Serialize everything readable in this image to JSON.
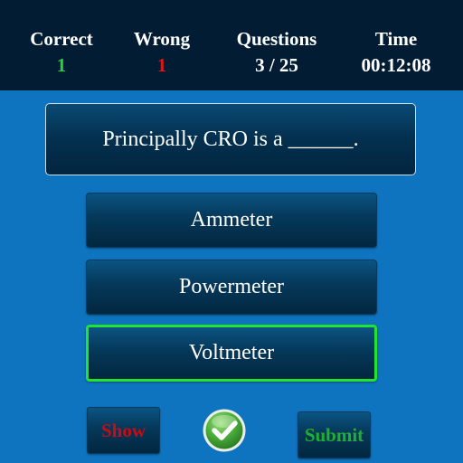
{
  "stats": {
    "correct": {
      "label": "Correct",
      "value": "1"
    },
    "wrong": {
      "label": "Wrong",
      "value": "1"
    },
    "questions": {
      "label": "Questions",
      "value": "3 / 25"
    },
    "time": {
      "label": "Time",
      "value": "00:12:08"
    }
  },
  "question": {
    "text": "Principally CRO is a ______."
  },
  "options": [
    {
      "label": "Ammeter",
      "selected": false
    },
    {
      "label": "Powermeter",
      "selected": false
    },
    {
      "label": "Voltmeter",
      "selected": true
    }
  ],
  "buttons": {
    "show": "Show",
    "submit": "Submit",
    "check_icon": "check-icon"
  },
  "colors": {
    "background": "#0f74bf",
    "header": "#021d33",
    "correct_value": "#27d23c",
    "wrong_value": "#e01616",
    "selected_border": "#22e330",
    "show_text": "#cc0a12",
    "submit_text": "#1fb032"
  }
}
